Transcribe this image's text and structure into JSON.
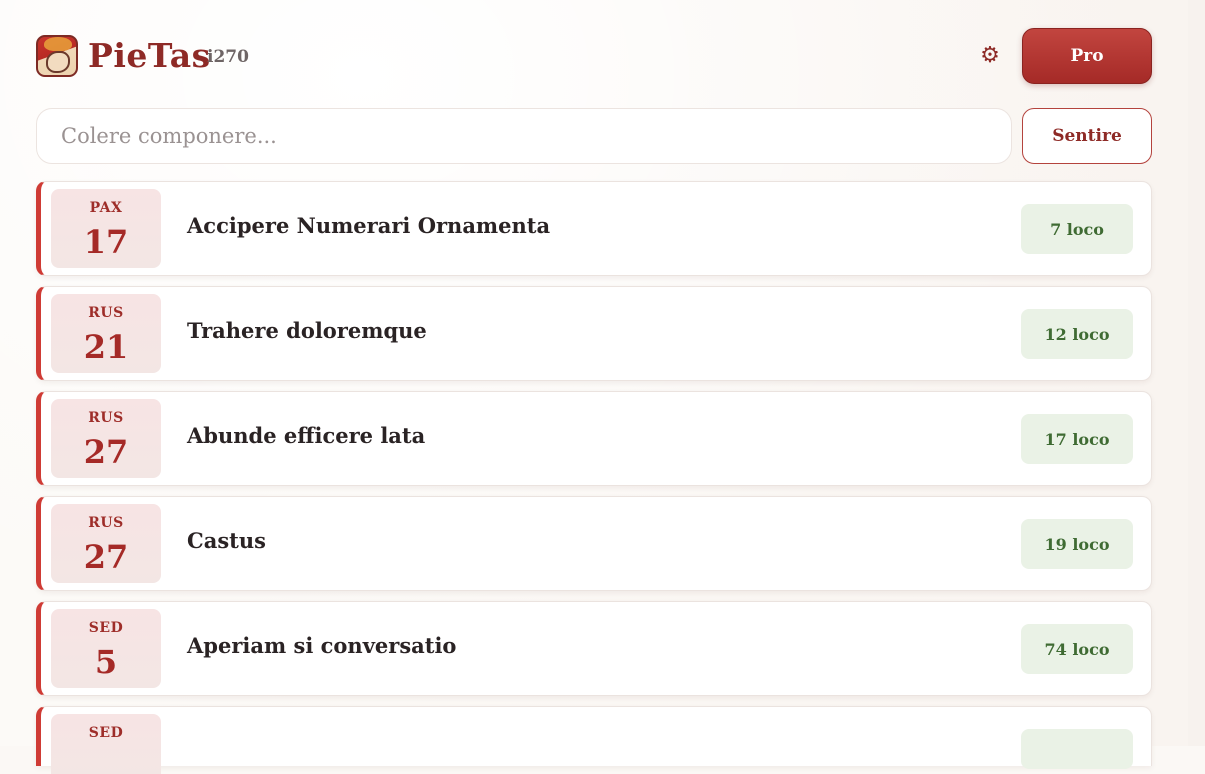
{
  "header": {
    "app_name": "PieTas",
    "version": "i270",
    "settings_icon": "gear-icon",
    "pro_label": "Pro"
  },
  "search": {
    "placeholder": "Colere componere...",
    "value": "",
    "listen_label": "Sentire"
  },
  "colors": {
    "accent": "#a52a27",
    "badge_bg": "#eaf2e6",
    "badge_text": "#3f6b33"
  },
  "entries": [
    {
      "dow": "PAX",
      "day": "17",
      "title": "Accipere Numerari Ornamenta",
      "count": "7 loco"
    },
    {
      "dow": "RUS",
      "day": "21",
      "title": "Trahere doloremque",
      "count": "12 loco"
    },
    {
      "dow": "RUS",
      "day": "27",
      "title": "Abunde efficere lata",
      "count": "17 loco"
    },
    {
      "dow": "RUS",
      "day": "27",
      "title": "Castus",
      "count": "19 loco"
    },
    {
      "dow": "SED",
      "day": "5",
      "title": "Aperiam si conversatio",
      "count": "74 loco"
    },
    {
      "dow": "SED",
      "day": "",
      "title": "",
      "count": ""
    }
  ]
}
